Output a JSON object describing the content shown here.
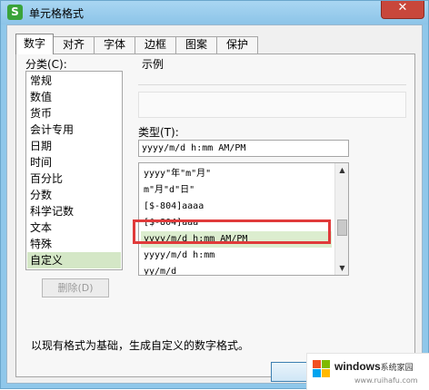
{
  "window": {
    "title": "单元格格式",
    "close_label": "✕",
    "app_icon": "S"
  },
  "tabs": [
    {
      "label": "数字",
      "active": true
    },
    {
      "label": "对齐"
    },
    {
      "label": "字体"
    },
    {
      "label": "边框"
    },
    {
      "label": "图案"
    },
    {
      "label": "保护"
    }
  ],
  "category": {
    "label": "分类(C):",
    "items": [
      "常规",
      "数值",
      "货币",
      "会计专用",
      "日期",
      "时间",
      "百分比",
      "分数",
      "科学记数",
      "文本",
      "特殊",
      "自定义"
    ],
    "selected": "自定义"
  },
  "sample": {
    "label": "示例"
  },
  "type_field": {
    "label": "类型(T):",
    "value": "yyyy/m/d h:mm AM/PM"
  },
  "format_list": {
    "items": [
      "yyyy\"年\"m\"月\"",
      "m\"月\"d\"日\"",
      "[$-804]aaaa",
      "[$-804]aaa",
      "yyyy/m/d h:mm AM/PM",
      "yyyy/m/d h:mm",
      "yy/m/d"
    ],
    "selected": "yyyy/m/d h:mm AM/PM",
    "scroll_up_icon": "▲",
    "scroll_down_icon": "▼"
  },
  "delete_button": {
    "label": "删除(D)"
  },
  "description": "以现有格式为基础，生成自定义的数字格式。",
  "watermark": {
    "brand": "windows",
    "suffix": "系统家园",
    "url": "www.ruihafu.com",
    "logo_colors": [
      "#f25022",
      "#7fba00",
      "#00a4ef",
      "#ffb900"
    ]
  },
  "colors": {
    "highlight": "#e03a3a",
    "selection": "#d4e7c6",
    "title_bar": "#8fc7ea"
  }
}
